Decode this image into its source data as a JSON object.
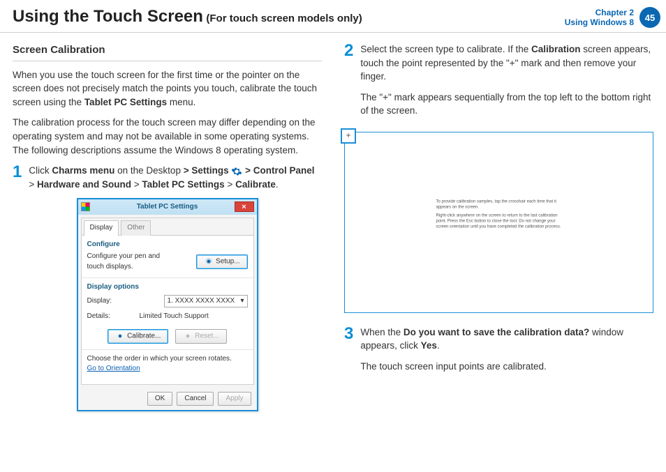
{
  "header": {
    "title": "Using the Touch Screen",
    "subtitle": "(For touch screen models only)",
    "chapter_line1": "Chapter 2",
    "chapter_line2": "Using Windows 8",
    "page_number": "45"
  },
  "left": {
    "section_title": "Screen Calibration",
    "p1a": "When you use the touch screen for the first time or the pointer on the screen does not precisely match the points you touch, calibrate the touch screen using the ",
    "p1b": "Tablet PC Settings",
    "p1c": " menu.",
    "p2": "The calibration process for the touch screen may differ depending on the operating system and may not be available in some operating systems. The following descriptions assume the Windows 8 operating system.",
    "step1_num": "1",
    "step1_a": "Click ",
    "step1_b": "Charms menu",
    "step1_c": " on the Desktop ",
    "step1_d": "> ",
    "step1_e": "Settings",
    "step1_f": " > ",
    "step1_g": "Control Panel",
    "step1_h": " > ",
    "step1_i": "Hardware and Sound",
    "step1_j": " > ",
    "step1_k": "Tablet PC Settings",
    "step1_l": " > ",
    "step1_m": "Calibrate",
    "step1_n": "."
  },
  "dialog": {
    "title": "Tablet PC Settings",
    "close": "×",
    "tab_display": "Display",
    "tab_other": "Other",
    "grp_configure": "Configure",
    "configure_text": "Configure your pen and touch displays.",
    "btn_setup": "Setup...",
    "grp_display": "Display options",
    "lbl_display": "Display:",
    "select_value": "1. XXXX XXXX XXXX",
    "lbl_details": "Details:",
    "details_value": "Limited Touch Support",
    "btn_calibrate": "Calibrate...",
    "btn_reset": "Reset...",
    "rotate_text": "Choose the order in which your screen rotates.",
    "rotate_link": "Go to Orientation",
    "btn_ok": "OK",
    "btn_cancel": "Cancel",
    "btn_apply": "Apply"
  },
  "right": {
    "step2_num": "2",
    "step2_a": "Select the screen type to calibrate. If the ",
    "step2_b": "Calibration",
    "step2_c": " screen appears, touch the point represented by the \"+\" mark and then remove your finger.",
    "step2_p2": "The \"+\" mark appears sequentially from the top left to the bottom right of the screen.",
    "cal_plus": "+",
    "cal_text1": "To provide calibration samples, tap the crosshair each time that it appears on the screen.",
    "cal_text2": "Right-click anywhere on the screen to return to the last calibration point. Press the Esc button to close the tool. Do not change your screen orientation until you have completed the calibration process.",
    "step3_num": "3",
    "step3_a": "When the ",
    "step3_b": "Do you want to save the calibration data?",
    "step3_c": " window appears, click ",
    "step3_d": "Yes",
    "step3_e": ".",
    "step3_p2": "The touch screen input points are calibrated."
  }
}
